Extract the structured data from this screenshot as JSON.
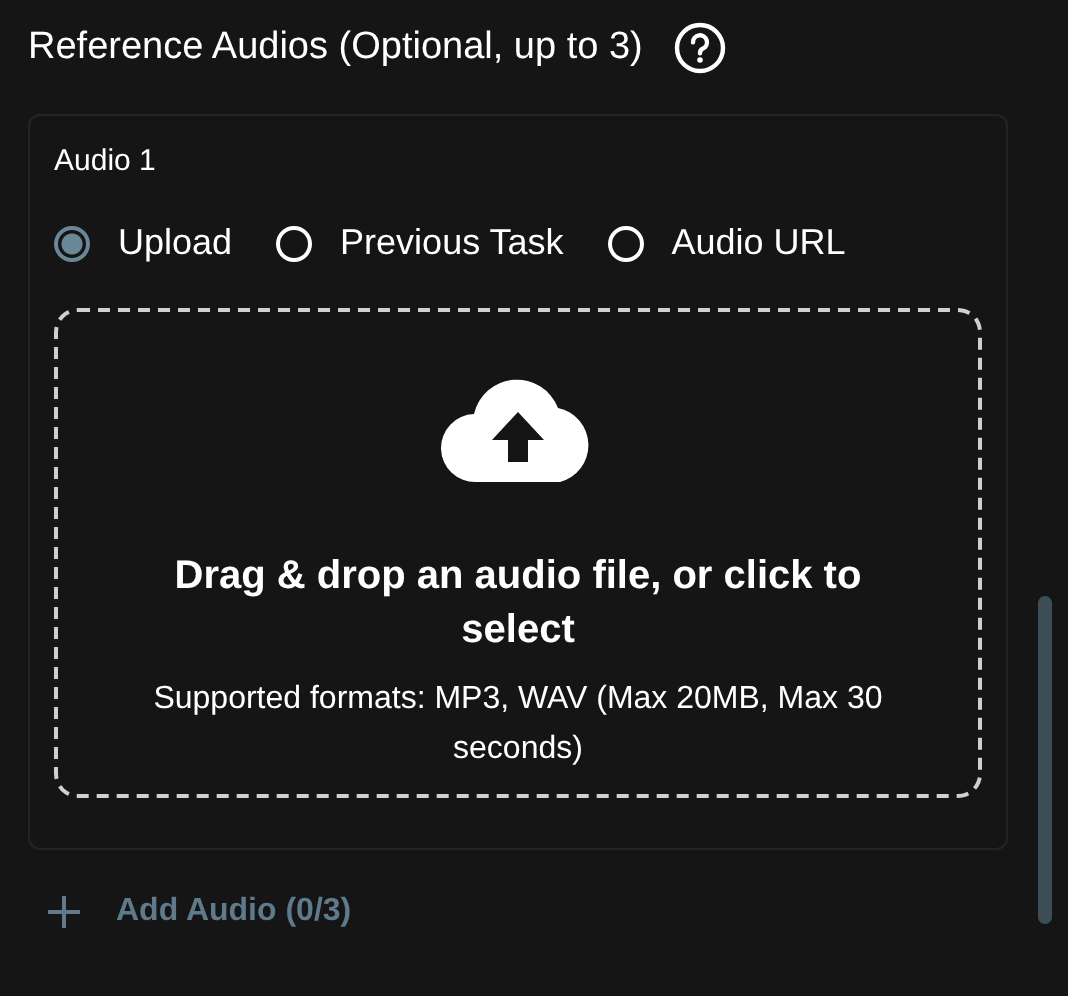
{
  "section": {
    "title": "Reference Audios (Optional, up to 3)"
  },
  "audio_card": {
    "title": "Audio 1",
    "source_options": [
      {
        "label": "Upload",
        "selected": true
      },
      {
        "label": "Previous Task",
        "selected": false
      },
      {
        "label": "Audio URL",
        "selected": false
      }
    ],
    "dropzone": {
      "heading": "Drag & drop an audio file, or click to select",
      "hint": "Supported formats: MP3, WAV (Max 20MB, Max 30 seconds)"
    }
  },
  "add_button": {
    "label": "Add Audio (0/3)"
  }
}
